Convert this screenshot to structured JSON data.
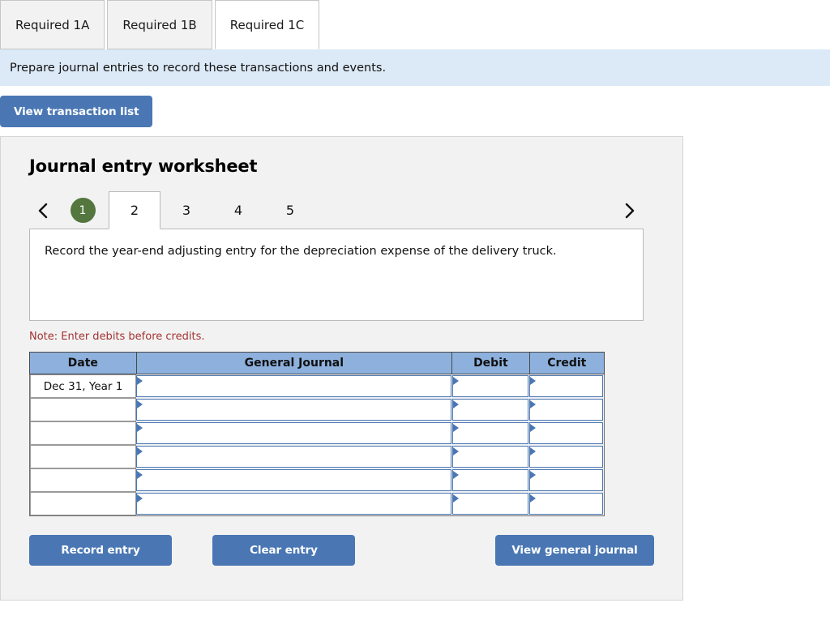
{
  "top_tabs": [
    {
      "label": "Required 1A",
      "active": false
    },
    {
      "label": "Required 1B",
      "active": false
    },
    {
      "label": "Required 1C",
      "active": true
    }
  ],
  "instruction": {
    "text": "Prepare journal entries to record these transactions and events."
  },
  "toolbar": {
    "view_transaction_list_label": "View transaction list"
  },
  "worksheet": {
    "title": "Journal entry worksheet",
    "pager": {
      "prev_icon": "chevron-left-icon",
      "next_icon": "chevron-right-icon",
      "pages": [
        {
          "label": "1",
          "state": "completed"
        },
        {
          "label": "2",
          "state": "active"
        },
        {
          "label": "3",
          "state": "default"
        },
        {
          "label": "4",
          "state": "default"
        },
        {
          "label": "5",
          "state": "default"
        }
      ]
    },
    "prompt": "Record the year-end adjusting entry for the depreciation expense of the delivery truck.",
    "note": "Note: Enter debits before credits.",
    "table": {
      "headers": [
        "Date",
        "General Journal",
        "Debit",
        "Credit"
      ],
      "rows": [
        {
          "date": "Dec 31, Year 1",
          "general_journal": "",
          "debit": "",
          "credit": ""
        },
        {
          "date": "",
          "general_journal": "",
          "debit": "",
          "credit": ""
        },
        {
          "date": "",
          "general_journal": "",
          "debit": "",
          "credit": ""
        },
        {
          "date": "",
          "general_journal": "",
          "debit": "",
          "credit": ""
        },
        {
          "date": "",
          "general_journal": "",
          "debit": "",
          "credit": ""
        },
        {
          "date": "",
          "general_journal": "",
          "debit": "",
          "credit": ""
        }
      ]
    },
    "actions": {
      "record_entry_label": "Record entry",
      "clear_entry_label": "Clear entry",
      "view_general_journal_label": "View general journal"
    }
  },
  "colors": {
    "button_blue": "#4a77b4",
    "banner_blue": "#dce9f6",
    "table_header_blue": "#8db0dd",
    "panel_gray": "#f2f2f2",
    "note_red": "#a33232",
    "completed_green": "#53773f"
  }
}
